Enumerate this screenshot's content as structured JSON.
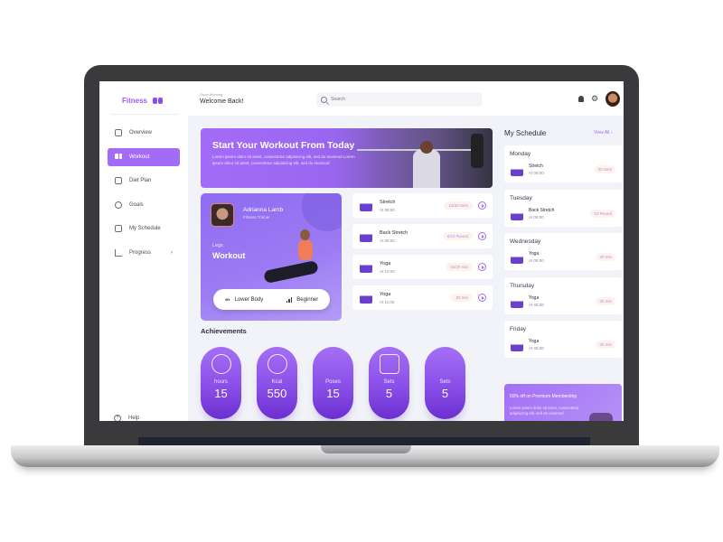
{
  "brand": {
    "name": "Fitness",
    "accent": "#a36cf7"
  },
  "sidebar": {
    "items": [
      {
        "label": "Overview",
        "icon": "grid-icon",
        "active": false
      },
      {
        "label": "Workout",
        "icon": "dumbbell-icon",
        "active": true
      },
      {
        "label": "Diet Plan",
        "icon": "diet-icon",
        "active": false
      },
      {
        "label": "Goals",
        "icon": "goals-icon",
        "active": false
      },
      {
        "label": "My Schedule",
        "icon": "calendar-icon",
        "active": false
      },
      {
        "label": "Progress",
        "icon": "chart-icon",
        "active": false,
        "has_submenu": true
      }
    ],
    "help_label": "Help"
  },
  "header": {
    "greeting_small": "Good Morning",
    "greeting": "Welcome Back!",
    "search_placeholder": "Search"
  },
  "hero": {
    "title": "Start Your Workout From Today",
    "text": "Lorem ipsum dolor sit amet, consectetur adipisicing elit, sed do eiusmod Lorem ipsum dolor sit amet, consectetur adipisicing elit, sed do eiusmod"
  },
  "trainer": {
    "name": "Adrianna Lamb",
    "role": "Fitness Trainer",
    "category": "Legs",
    "title": "Workout",
    "tags": [
      "Lower Body",
      "Beginner"
    ]
  },
  "exercises": [
    {
      "name": "Stretch",
      "time": "At 08:00",
      "badge": "10/20 Sets"
    },
    {
      "name": "Back Stretch",
      "time": "At 09:00",
      "badge": "6/10 Round"
    },
    {
      "name": "Yoga",
      "time": "At 10:00",
      "badge": "04/20 min"
    },
    {
      "name": "Yoga",
      "time": "At 11:00",
      "badge": "20 min"
    }
  ],
  "achievements": {
    "title": "Achievements",
    "items": [
      {
        "label": "hours",
        "value": "15",
        "icon": "clock-icon"
      },
      {
        "label": "Kcal",
        "value": "550",
        "icon": "flame-icon"
      },
      {
        "label": "Poses",
        "value": "15",
        "icon": "yoga-pose-icon"
      },
      {
        "label": "Sets",
        "value": "5",
        "icon": "dumbbell-fist-icon"
      },
      {
        "label": "Sets",
        "value": "5",
        "icon": "footsteps-icon"
      }
    ]
  },
  "schedule": {
    "title": "My Schedule",
    "view_all": "View All",
    "days": [
      {
        "day": "Monday",
        "name": "Stretch",
        "time": "At 08:00",
        "badge": "20 Sets"
      },
      {
        "day": "Tuesday",
        "name": "Back Stretch",
        "time": "At 08:00",
        "badge": "10 Round"
      },
      {
        "day": "Wednesday",
        "name": "Yoga",
        "time": "At 08:00",
        "badge": "20 min"
      },
      {
        "day": "Thursday",
        "name": "Yoga",
        "time": "At 08:00",
        "badge": "20 min"
      },
      {
        "day": "Friday",
        "name": "Yoga",
        "time": "At 08:00",
        "badge": "20 min"
      }
    ]
  },
  "promo": {
    "title": "50% off on Premium Membership",
    "text": "Lorem ipsum dolor sit amet, consectetur adipisicing elit, sed do eiusmod"
  }
}
